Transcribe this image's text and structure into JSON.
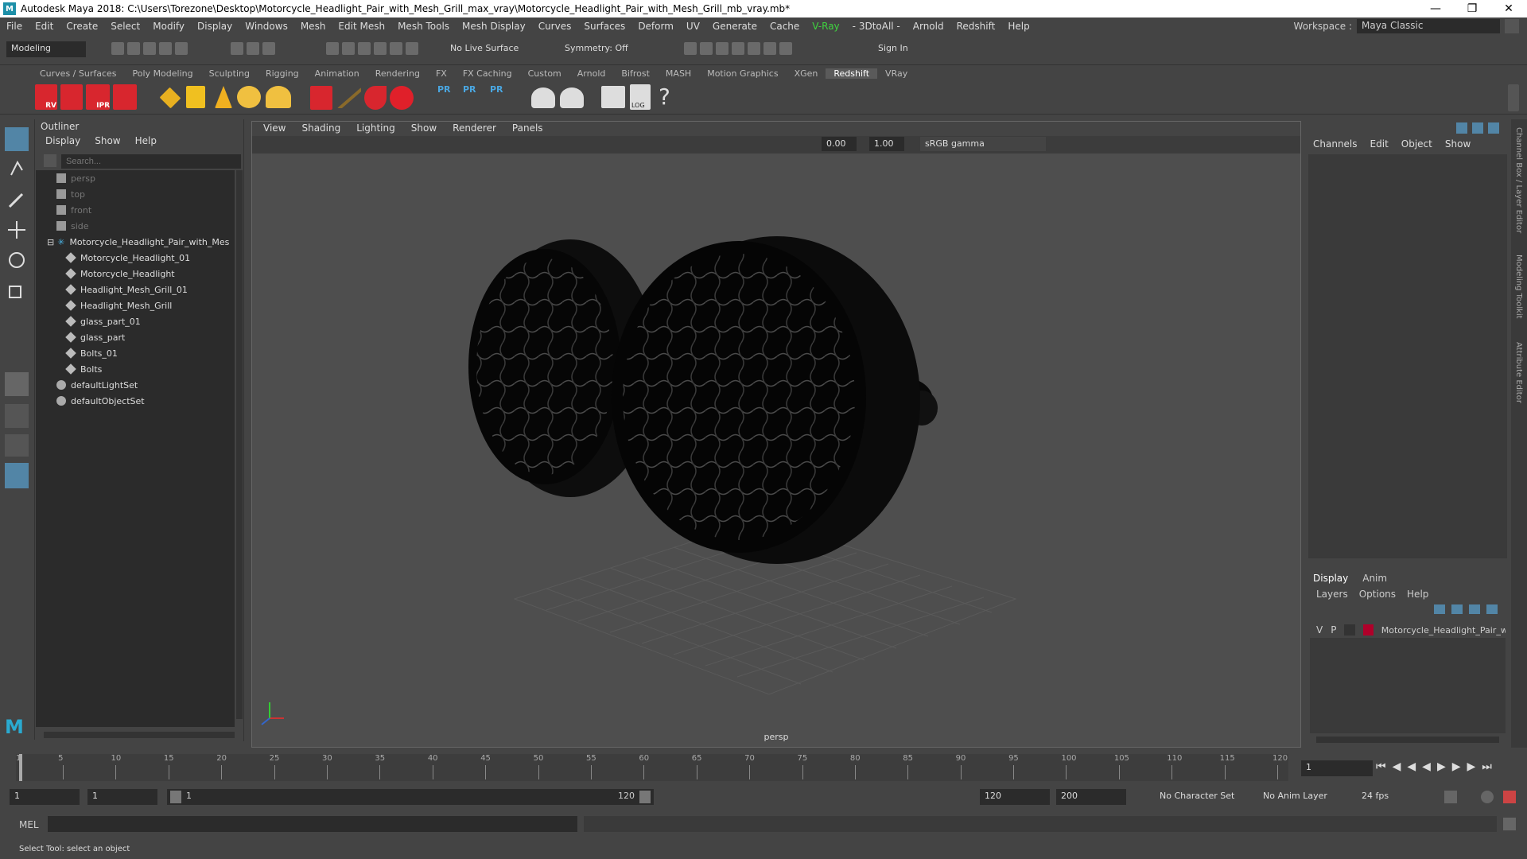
{
  "title": "Autodesk Maya 2018: C:\\Users\\Torezone\\Desktop\\Motorcycle_Headlight_Pair_with_Mesh_Grill_max_vray\\Motorcycle_Headlight_Pair_with_Mesh_Grill_mb_vray.mb*",
  "logo": "M",
  "menus": [
    "File",
    "Edit",
    "Create",
    "Select",
    "Modify",
    "Display",
    "Windows",
    "Mesh",
    "Edit Mesh",
    "Mesh Tools",
    "Mesh Display",
    "Curves",
    "Surfaces",
    "Deform",
    "UV",
    "Generate",
    "Cache",
    "V-Ray",
    "- 3DtoAll -",
    "Arnold",
    "Redshift",
    "Help"
  ],
  "workspace": {
    "label": "Workspace :",
    "value": "Maya Classic"
  },
  "status": {
    "menu_set": "Modeling",
    "live_surface": "No Live Surface",
    "symmetry": "Symmetry: Off",
    "sign_in": "Sign In"
  },
  "shelf_tabs": [
    "Curves / Surfaces",
    "Poly Modeling",
    "Sculpting",
    "Rigging",
    "Animation",
    "Rendering",
    "FX",
    "FX Caching",
    "Custom",
    "Arnold",
    "Bifrost",
    "MASH",
    "Motion Graphics",
    "XGen",
    "Redshift",
    "VRay"
  ],
  "active_shelf": "Redshift",
  "shelf_labels": {
    "rv": "RV",
    "ipr": "IPR",
    "pr": "PR",
    "log": "LOG"
  },
  "outliner": {
    "title": "Outliner",
    "menus": [
      "Display",
      "Show",
      "Help"
    ],
    "search_placeholder": "Search...",
    "items": [
      {
        "label": "persp",
        "indent": 1,
        "dim": true,
        "icon": "camera"
      },
      {
        "label": "top",
        "indent": 1,
        "dim": true,
        "icon": "camera"
      },
      {
        "label": "front",
        "indent": 1,
        "dim": true,
        "icon": "camera"
      },
      {
        "label": "side",
        "indent": 1,
        "dim": true,
        "icon": "camera"
      },
      {
        "label": "Motorcycle_Headlight_Pair_with_Mes",
        "indent": 0,
        "dim": false,
        "icon": "group"
      },
      {
        "label": "Motorcycle_Headlight_01",
        "indent": 2,
        "dim": false,
        "icon": "mesh"
      },
      {
        "label": "Motorcycle_Headlight",
        "indent": 2,
        "dim": false,
        "icon": "mesh"
      },
      {
        "label": "Headlight_Mesh_Grill_01",
        "indent": 2,
        "dim": false,
        "icon": "mesh"
      },
      {
        "label": "Headlight_Mesh_Grill",
        "indent": 2,
        "dim": false,
        "icon": "mesh"
      },
      {
        "label": "glass_part_01",
        "indent": 2,
        "dim": false,
        "icon": "mesh"
      },
      {
        "label": "glass_part",
        "indent": 2,
        "dim": false,
        "icon": "mesh"
      },
      {
        "label": "Bolts_01",
        "indent": 2,
        "dim": false,
        "icon": "mesh"
      },
      {
        "label": "Bolts",
        "indent": 2,
        "dim": false,
        "icon": "mesh"
      },
      {
        "label": "defaultLightSet",
        "indent": 1,
        "dim": false,
        "icon": "set"
      },
      {
        "label": "defaultObjectSet",
        "indent": 1,
        "dim": false,
        "icon": "set"
      }
    ]
  },
  "viewport": {
    "menus": [
      "View",
      "Shading",
      "Lighting",
      "Show",
      "Renderer",
      "Panels"
    ],
    "exposure": "0.00",
    "gamma": "1.00",
    "color_space": "sRGB gamma",
    "camera_label": "persp"
  },
  "channel_box": {
    "menus": [
      "Channels",
      "Edit",
      "Object",
      "Show"
    ]
  },
  "layer_editor": {
    "tabs": [
      "Display",
      "Anim"
    ],
    "menus": [
      "Layers",
      "Options",
      "Help"
    ],
    "layer": {
      "v": "V",
      "p": "P",
      "name": "Motorcycle_Headlight_Pair_wit",
      "color": "#b0002a"
    }
  },
  "side_tabs": [
    "Channel Box / Layer Editor",
    "Modeling Toolkit",
    "Attribute Editor"
  ],
  "timeline": {
    "ticks": [
      "1",
      "5",
      "10",
      "15",
      "20",
      "25",
      "30",
      "35",
      "40",
      "45",
      "50",
      "55",
      "60",
      "65",
      "70",
      "75",
      "80",
      "85",
      "90",
      "95",
      "100",
      "105",
      "110",
      "115",
      "120"
    ],
    "current_frame": "1"
  },
  "range": {
    "start": "1",
    "inner_start": "1",
    "slider_start": "1",
    "slider_end": "120",
    "end": "120",
    "total_end": "200",
    "character_set": "No Character Set",
    "anim_layer": "No Anim Layer",
    "fps": "24 fps"
  },
  "cmd": {
    "label": "MEL"
  },
  "help_line": "Select Tool: select an object",
  "colors": {
    "accent": "#5285a6",
    "vray_green": "#3fd43f",
    "redshift_red": "#e02030"
  }
}
